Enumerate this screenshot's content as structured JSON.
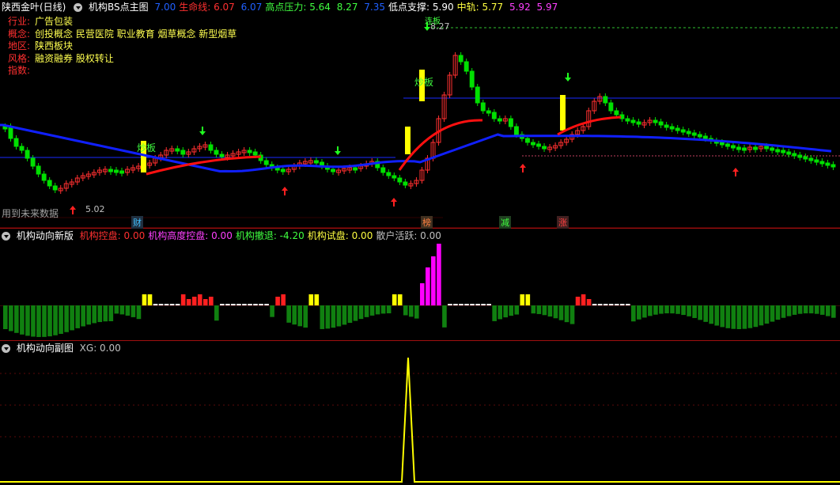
{
  "main_header": {
    "stock_title": "陕西金叶(日线)",
    "indicator_name": "机构BS点主图",
    "values": [
      {
        "label": "",
        "value": "7.00",
        "color": "#2060ff"
      },
      {
        "label": "生命线:",
        "value": "6.07",
        "color": "#ff3030"
      },
      {
        "label": "",
        "value": "6.07",
        "color": "#2060ff"
      },
      {
        "label": "高点压力:",
        "value": "5.64",
        "color": "#40ff40"
      },
      {
        "label": "",
        "value": "8.27",
        "color": "#40ff40"
      },
      {
        "label": "",
        "value": "7.35",
        "color": "#2060ff"
      },
      {
        "label": "低点支撑:",
        "value": "5.90",
        "color": "#ffffff"
      },
      {
        "label": "中轨:",
        "value": "5.77",
        "color": "#ffff40"
      },
      {
        "label": "",
        "value": "5.92",
        "color": "#ff40ff"
      },
      {
        "label": "",
        "value": "5.97",
        "color": "#ff40ff"
      }
    ]
  },
  "info_panel": {
    "rows": [
      {
        "key": "行业:",
        "value": "广告包装"
      },
      {
        "key": "概念:",
        "value": "创投概念 民营医院 职业教育 烟草概念 新型烟草"
      },
      {
        "key": "地区:",
        "value": "陕西板块"
      },
      {
        "key": "风格:",
        "value": "融资融券 股权转让"
      },
      {
        "key": "指数:",
        "value": ""
      }
    ]
  },
  "main_annotations": {
    "high_price": "8.27",
    "low_price": "5.02",
    "future_data_note": "用到未来数据",
    "peak_label": "连板",
    "zt_label_1": "炒板",
    "zt_label_2": "炒板"
  },
  "event_tags": [
    {
      "text": "财",
      "color": "#40c0ff"
    },
    {
      "text": "榜",
      "color": "#ff8040"
    },
    {
      "text": "减",
      "color": "#40ff40"
    },
    {
      "text": "涨",
      "color": "#ff4040"
    }
  ],
  "mid_header": {
    "indicator_name": "机构动向新版",
    "values": [
      {
        "label": "机构控盘:",
        "value": "0.00",
        "color": "#ff3030"
      },
      {
        "label": "机构高度控盘:",
        "value": "0.00",
        "color": "#ff40ff"
      },
      {
        "label": "机构撤退:",
        "value": "-4.20",
        "color": "#40ff40"
      },
      {
        "label": "机构试盘:",
        "value": "0.00",
        "color": "#ffff40"
      },
      {
        "label": "散户活跃:",
        "value": "0.00",
        "color": "#c0c0c0"
      }
    ]
  },
  "bottom_header": {
    "indicator_name": "机构动向副图",
    "values": [
      {
        "label": "XG:",
        "value": "0.00",
        "color": "#c0c0c0"
      }
    ]
  },
  "colors": {
    "up": "#ff3030",
    "down": "#00e000",
    "ma_blue": "#1020ff",
    "ma_red": "#ff1010",
    "yellow": "#ffff00",
    "magenta": "#ff00ff",
    "green_bar": "#108010"
  },
  "icons": [
    "dropdown-triangle-icon",
    "indicator-menu-icon",
    "buy-arrow-icon",
    "sell-arrow-icon"
  ]
}
